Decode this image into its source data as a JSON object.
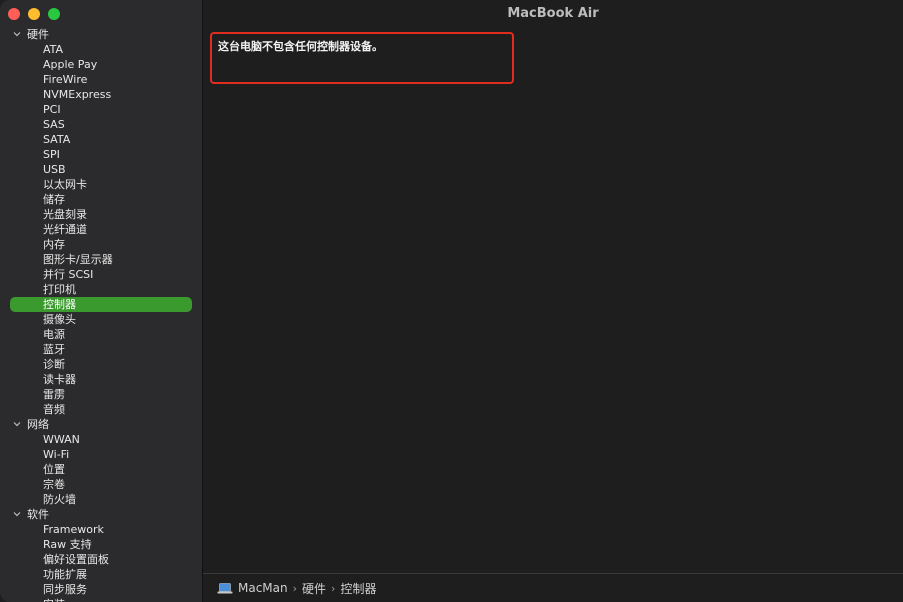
{
  "window": {
    "title": "MacBook Air"
  },
  "sidebar": {
    "groups": [
      {
        "label": "硬件",
        "items": [
          "ATA",
          "Apple Pay",
          "FireWire",
          "NVMExpress",
          "PCI",
          "SAS",
          "SATA",
          "SPI",
          "USB",
          "以太网卡",
          "储存",
          "光盘刻录",
          "光纤通道",
          "内存",
          "图形卡/显示器",
          "并行 SCSI",
          "打印机",
          "控制器",
          "摄像头",
          "电源",
          "蓝牙",
          "诊断",
          "读卡器",
          "雷雳",
          "音频"
        ]
      },
      {
        "label": "网络",
        "items": [
          "WWAN",
          "Wi-Fi",
          "位置",
          "宗卷",
          "防火墙"
        ]
      },
      {
        "label": "软件",
        "items": [
          "Framework",
          "Raw 支持",
          "偏好设置面板",
          "功能扩展",
          "同步服务",
          "安装"
        ]
      }
    ],
    "selected": "控制器"
  },
  "main": {
    "message": "这台电脑不包含任何控制器设备。"
  },
  "statusbar": {
    "path": [
      "MacMan",
      "硬件",
      "控制器"
    ],
    "separator": "›"
  },
  "colors": {
    "selection": "#3a9a2d",
    "highlight_box": "#e02d1f"
  }
}
